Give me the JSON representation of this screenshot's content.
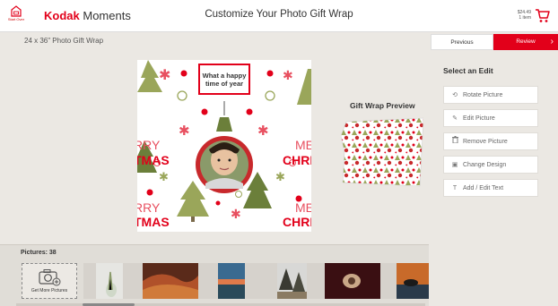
{
  "header": {
    "home_label": "Start Over",
    "logo_brand": "Kodak",
    "logo_product": "Moments",
    "title": "Customize Your Photo Gift Wrap",
    "cart_price": "$24.49",
    "cart_items": "1 item"
  },
  "subheader": {
    "product_name": "24 x 36\" Photo Gift Wrap",
    "previous_label": "Previous",
    "review_label": "Review"
  },
  "design": {
    "banner_text_line1": "What a happy",
    "banner_text_line2": "time of year",
    "left_text_1": "RRY",
    "left_text_2": "TMAS",
    "right_text_1": "ME",
    "right_text_2": "CHRIS",
    "left_text_3": "RRY",
    "left_text_4": "TMAS",
    "right_text_3": "ME",
    "right_text_4": "CHRIS"
  },
  "preview": {
    "label": "Gift Wrap Preview"
  },
  "edits": {
    "title": "Select an Edit",
    "items": [
      {
        "icon": "rotate-icon",
        "glyph": "⟲",
        "label": "Rotate Picture"
      },
      {
        "icon": "edit-icon",
        "glyph": "✎",
        "label": "Edit Picture"
      },
      {
        "icon": "trash-icon",
        "glyph": "🗑",
        "label": "Remove Picture"
      },
      {
        "icon": "design-icon",
        "glyph": "▣",
        "label": "Change Design"
      },
      {
        "icon": "text-icon",
        "glyph": "T",
        "label": "Add / Edit Text"
      }
    ]
  },
  "filmstrip": {
    "count_label": "Pictures: 38",
    "get_more_label": "Get More Pictures"
  },
  "colors": {
    "brand_red": "#e2001a",
    "tree_green": "#9aa65a",
    "dark_green": "#6b7f3a"
  }
}
